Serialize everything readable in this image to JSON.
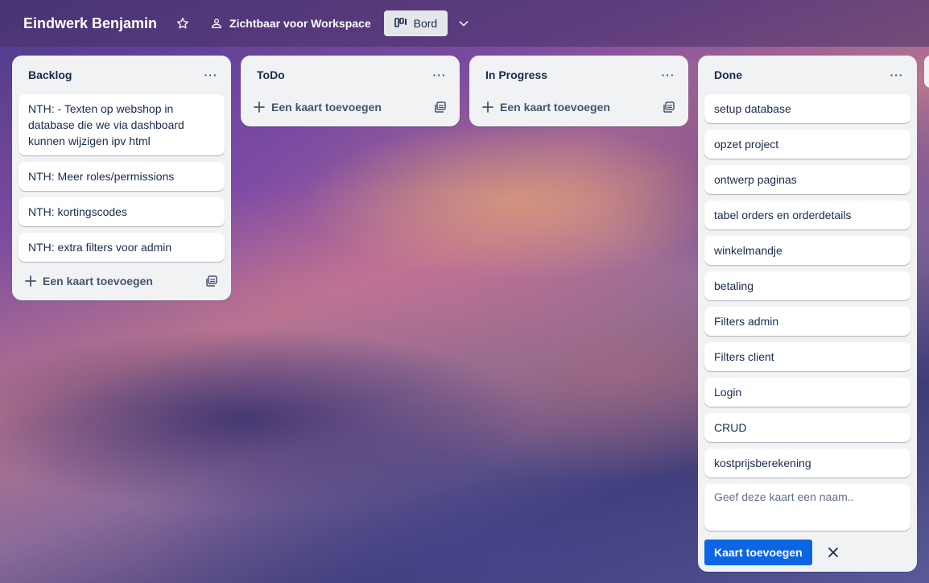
{
  "header": {
    "board_title": "Eindwerk Benjamin",
    "visibility_label": "Zichtbaar voor Workspace",
    "view_label": "Bord"
  },
  "lists": [
    {
      "title": "Backlog",
      "cards": [
        "NTH: - Texten op webshop in database die we via dashboard kunnen wijzigen ipv html",
        "NTH: Meer roles/permissions",
        "NTH: kortingscodes",
        "NTH: extra filters voor admin"
      ],
      "add_card_label": "Een kaart toevoegen"
    },
    {
      "title": "ToDo",
      "cards": [],
      "add_card_label": "Een kaart toevoegen"
    },
    {
      "title": "In Progress",
      "cards": [],
      "add_card_label": "Een kaart toevoegen"
    },
    {
      "title": "Done",
      "cards": [
        "setup database",
        "opzet project",
        "ontwerp paginas",
        "tabel orders en orderdetails",
        "winkelmandje",
        "betaling",
        "Filters admin",
        "Filters client",
        "Login",
        "CRUD",
        "kostprijsberekening"
      ],
      "composer_placeholder": "Geef deze kaart een naam..",
      "composer_submit_label": "Kaart toevoegen"
    }
  ],
  "icons": {
    "star": "star-icon",
    "visibility": "people-icon",
    "view": "board-icon",
    "chevron": "chevron-down-icon",
    "menu": "more-icon",
    "add": "plus-icon",
    "template": "template-icon",
    "close": "close-icon"
  },
  "colors": {
    "list_bg": "#f1f2f4",
    "primary_button": "#0c66e4",
    "text": "#172b4d"
  }
}
